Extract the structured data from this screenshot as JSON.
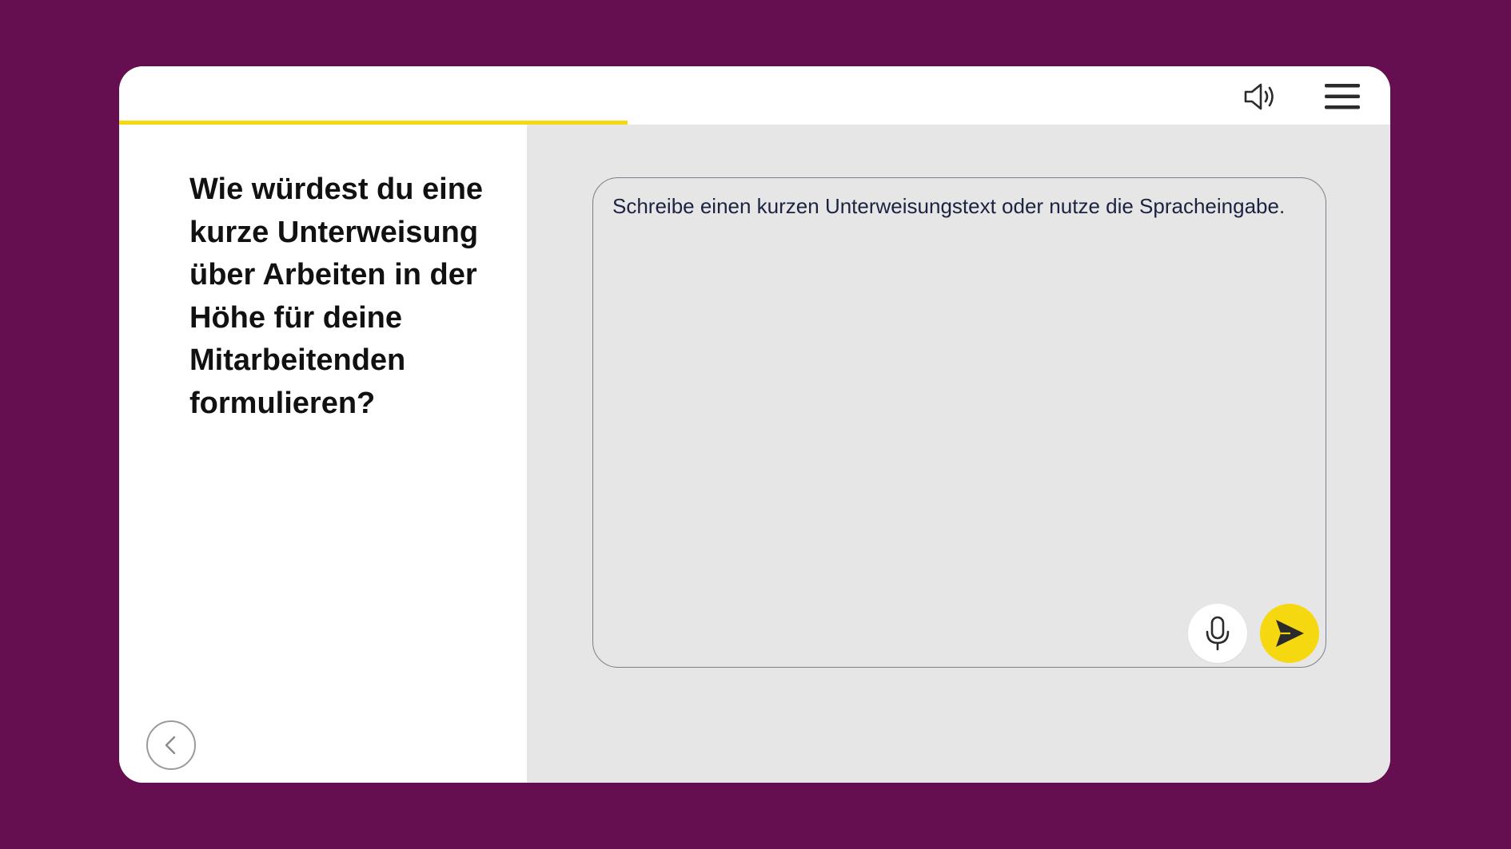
{
  "header": {
    "progress_percent": 40,
    "sound_icon": "speaker-icon",
    "menu_icon": "hamburger-menu-icon"
  },
  "question": {
    "text": "Wie würdest du eine kurze Unterweisung über Arbeiten in der Höhe für deine Mitarbeitenden formulieren?"
  },
  "answer": {
    "placeholder": "Schreibe einen kurzen Unterweisungstext oder nutze die Spracheingabe.",
    "value": "",
    "mic_icon": "microphone-icon",
    "send_icon": "send-icon"
  },
  "navigation": {
    "back_icon": "chevron-left-icon"
  },
  "colors": {
    "background": "#650f50",
    "accent": "#f5d80f",
    "panel_gray": "#e6e6e6",
    "card": "#ffffff"
  }
}
